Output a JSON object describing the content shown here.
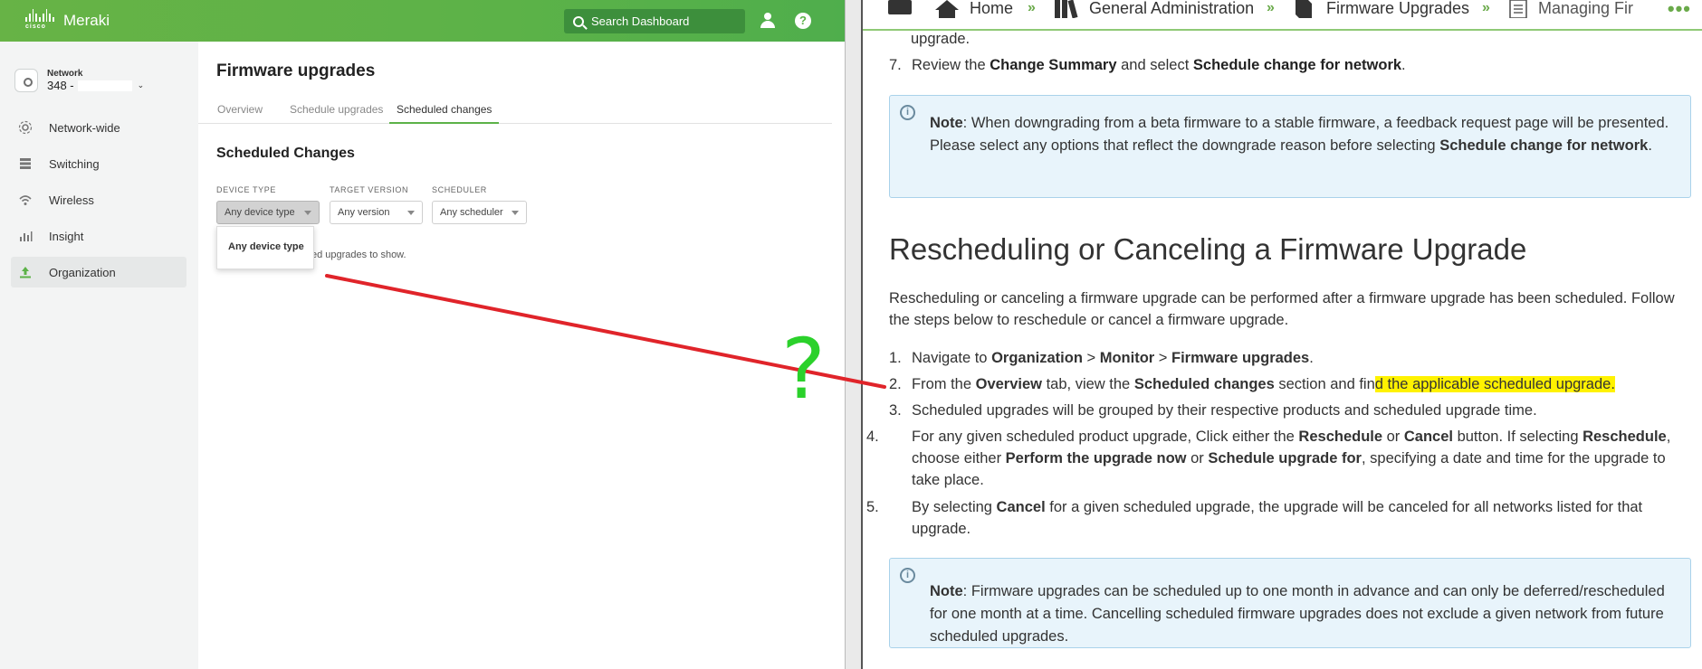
{
  "dashboard": {
    "brand": {
      "cisco": "cisco",
      "product": "Meraki"
    },
    "search_placeholder": "Search Dashboard",
    "network": {
      "label": "Network",
      "value": "348 -"
    },
    "sidebar": [
      {
        "label": "Network-wide",
        "icon": "network-wide-icon"
      },
      {
        "label": "Switching",
        "icon": "switching-icon"
      },
      {
        "label": "Wireless",
        "icon": "wireless-icon"
      },
      {
        "label": "Insight",
        "icon": "insight-icon"
      },
      {
        "label": "Organization",
        "icon": "organization-icon",
        "active": true
      }
    ],
    "page_title": "Firmware upgrades",
    "tabs": [
      "Overview",
      "Schedule upgrades",
      "Scheduled changes"
    ],
    "active_tab": "Scheduled changes",
    "section_title": "Scheduled Changes",
    "filters": {
      "device_type": {
        "label": "DEVICE TYPE",
        "value": "Any device type"
      },
      "target_version": {
        "label": "TARGET VERSION",
        "value": "Any version"
      },
      "scheduler": {
        "label": "SCHEDULER",
        "value": "Any scheduler"
      }
    },
    "dropdown_option": "Any device type",
    "empty_message": "ed upgrades to show."
  },
  "doc": {
    "breadcrumbs": [
      "Home",
      "General Administration",
      "Firmware Upgrades",
      "Managing Fir"
    ],
    "top_fragment": "upgrade.",
    "step7": {
      "n": "7.",
      "pre": "Review the ",
      "b1": "Change Summary",
      "mid": " and select ",
      "b2": "Schedule change for network",
      "post": "."
    },
    "note1": {
      "b": "Note",
      "t1": ": When downgrading from a beta firmware to a stable firmware, a feedback request page will be presented. Please select any options that reflect the downgrade reason before selecting ",
      "b2": "Schedule change for network",
      "t2": "."
    },
    "heading": "Rescheduling or Canceling a Firmware Upgrade",
    "intro": "Rescheduling or canceling a firmware upgrade can be performed after a firmware upgrade has been scheduled. Follow the steps below to reschedule or cancel a firmware upgrade.",
    "steps": {
      "s1": {
        "n": "1.",
        "t1": "Navigate to ",
        "b1": "Organization",
        "t2": " > ",
        "b2": "Monitor",
        "t3": " > ",
        "b3": "Firmware upgrades",
        "t4": "."
      },
      "s2": {
        "n": "2.",
        "t1": "From the ",
        "b1": "Overview",
        "t2": " tab, view the ",
        "b2": "Scheduled changes",
        "t3": " section and fin",
        "hl": "d the applicable scheduled upgrade."
      },
      "s3": {
        "n": "3.",
        "t": "Scheduled upgrades will be grouped by their respective products and scheduled upgrade time."
      },
      "s4": {
        "n": "4.",
        "t1": "For any given scheduled product upgrade, Click either the ",
        "b1": "Reschedule",
        "t2": " or ",
        "b2": "Cancel",
        "t3": " button. If selecting ",
        "b3": "Reschedule",
        "t4": ", choose either ",
        "b4": "Perform the upgrade now",
        "t5": " or ",
        "b5": "Schedule upgrade for",
        "t6": ", specifying a date and time for the upgrade to take place."
      },
      "s5": {
        "n": "5.",
        "t1": "By selecting ",
        "b1": "Cancel",
        "t2": " for a given scheduled upgrade, the upgrade will be canceled for all networks listed for that upgrade."
      }
    },
    "note2": {
      "b": "Note",
      "t": ": Firmware upgrades can be scheduled up to one month in advance and can only be deferred/rescheduled for one month at a time. Cancelling scheduled firmware upgrades does not exclude a given network from future scheduled upgrades."
    }
  },
  "annotation": {
    "mark": "?",
    "arrow_color": "#e0242a",
    "mark_color": "#2bd12b"
  },
  "colors": {
    "meraki_green": "#5cb248",
    "note_bg": "#e8f4fb",
    "highlight": "#fff200"
  }
}
